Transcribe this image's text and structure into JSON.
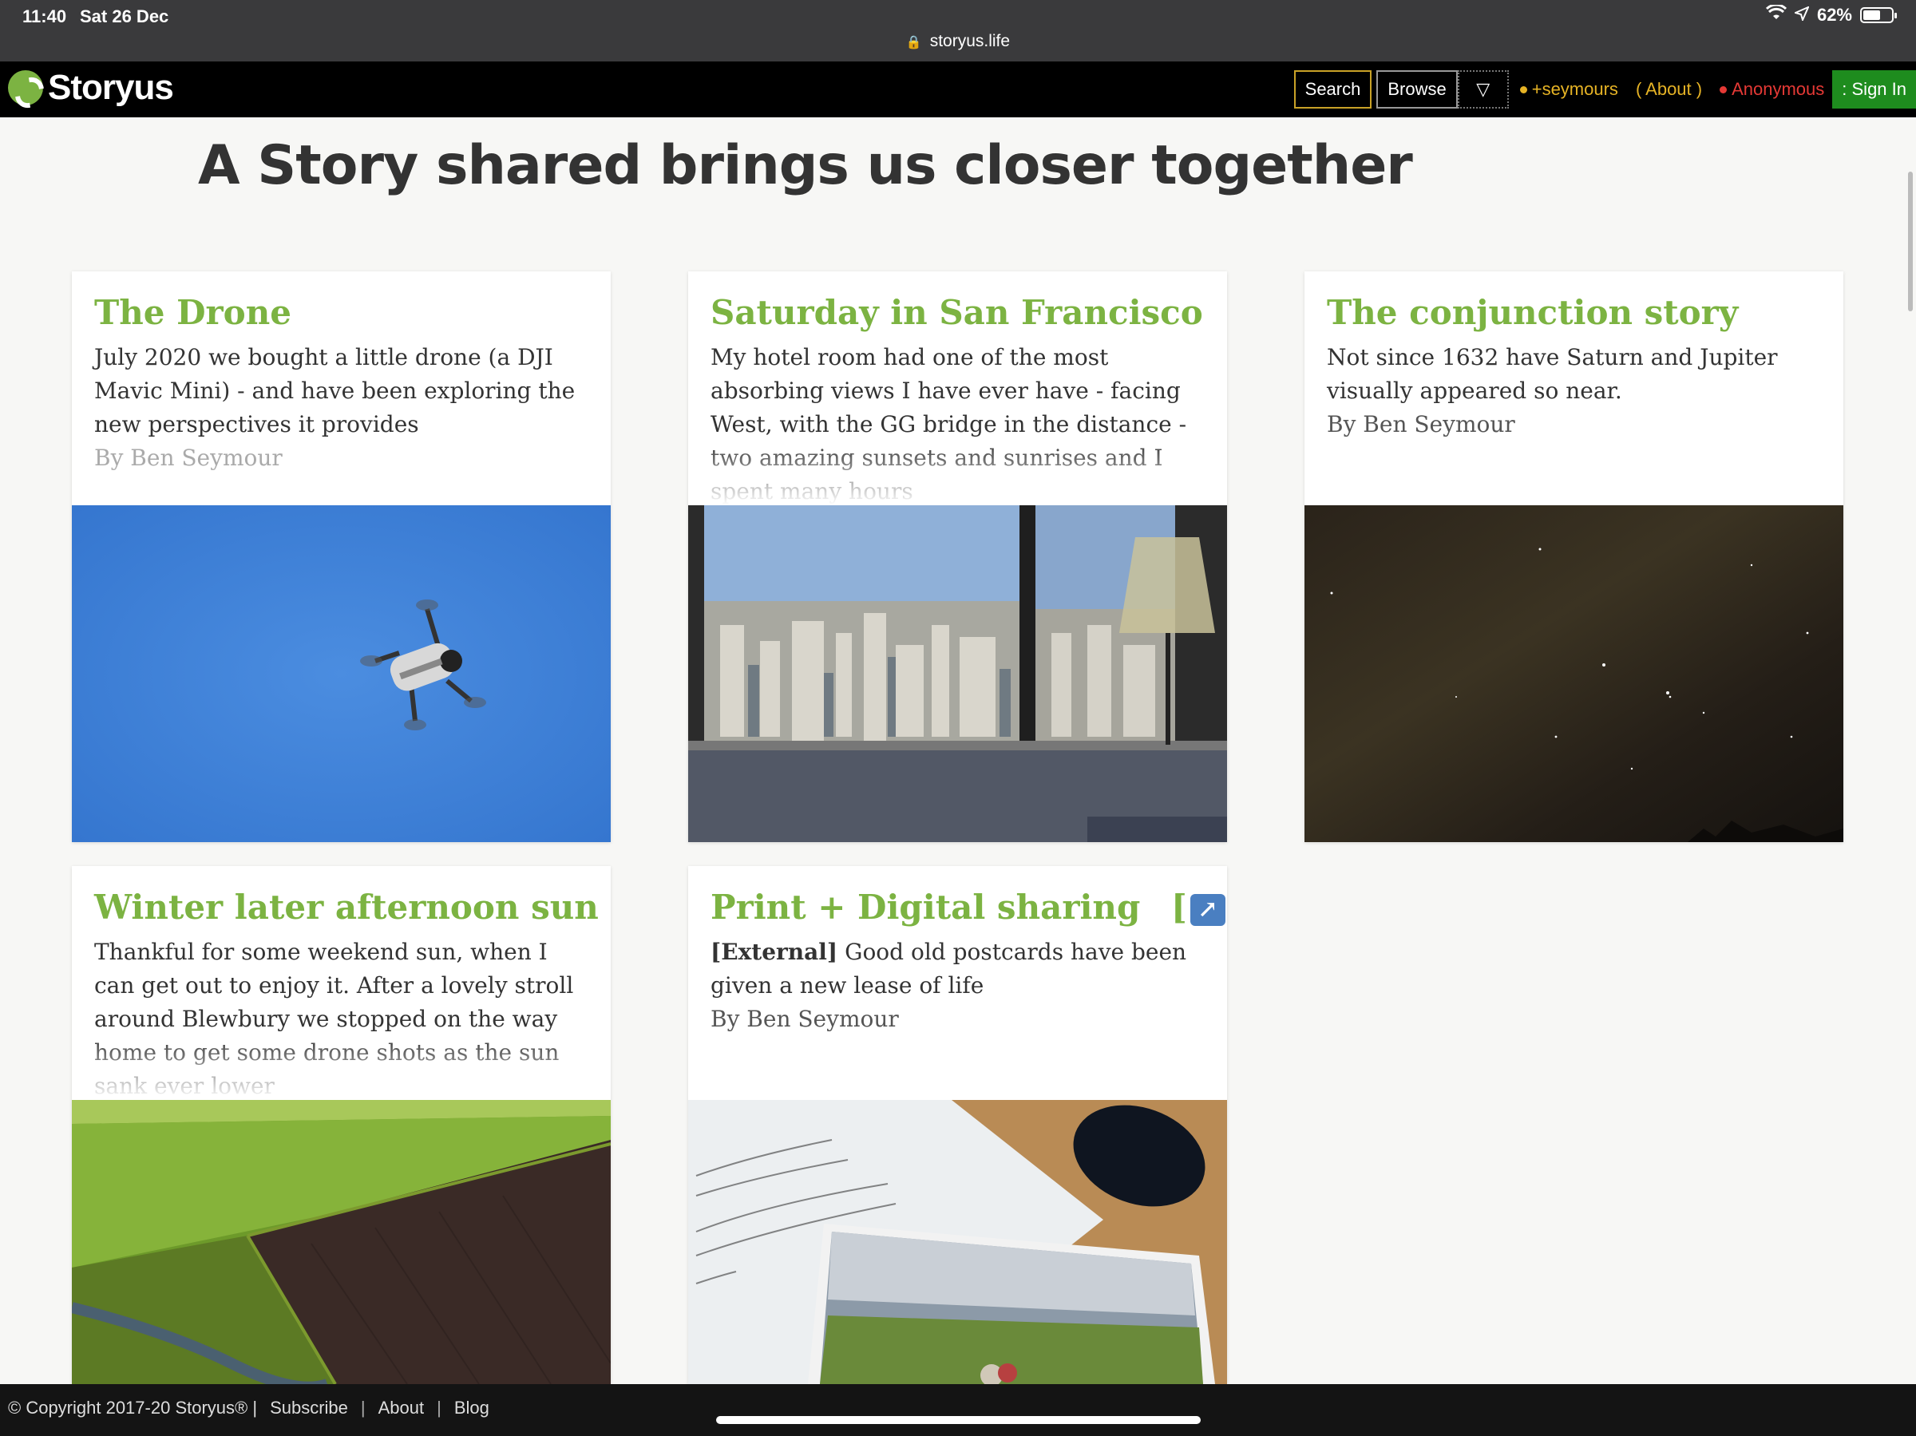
{
  "status_bar": {
    "time": "11:40",
    "date": "Sat 26 Dec",
    "url": "storyus.life",
    "battery_text": "62%",
    "battery_level": 0.62
  },
  "nav": {
    "logo_text": "Storyus",
    "search_label": "Search",
    "browse_label": "Browse",
    "filter_symbol": "▽",
    "user_label": "+seymours",
    "about_label": "( About )",
    "anonymous_label": "Anonymous",
    "signin_label": ": Sign In"
  },
  "headline": "A Story shared brings us closer together",
  "cards": [
    {
      "title": "The Drone",
      "body": "July 2020 we bought a little drone (a DJI Mavic Mini) - and have been exploring the new perspectives it provides",
      "byline": "By Ben Seymour",
      "image_desc": "drone in blue sky"
    },
    {
      "title": "Saturday in San Francisco",
      "body": "My hotel room had one of the most absorbing views I have ever have - facing West, with the GG bridge in the distance - two amazing sunsets and sunrises and I spent many hours",
      "byline": "",
      "image_desc": "city view from hotel window"
    },
    {
      "title": "The conjunction story",
      "body": "Not since 1632 have Saturn and Jupiter visually appeared so near.",
      "byline": "By Ben Seymour",
      "image_desc": "night sky with stars"
    },
    {
      "title": "Winter later afternoon sun",
      "body": "Thankful for some weekend sun, when I can get out to enjoy it. After a lovely stroll around Blewbury we stopped on the way home to get some drone shots as the sun sank ever lower",
      "byline": "",
      "image_desc": "aerial view of green fields"
    },
    {
      "title": "Print + Digital sharing",
      "title_suffix_open": "[",
      "title_suffix_icon": "↗",
      "title_suffix_close": "]",
      "external_tag": "[External]",
      "body": "Good old postcards have been given a new lease of life",
      "byline": "By Ben Seymour",
      "image_desc": "postcards and mouse on desk"
    }
  ],
  "footer": {
    "copyright": "© Copyright 2017-20 Storyus® |",
    "subscribe": "Subscribe",
    "about": "About",
    "blog": "Blog",
    "sep": "|"
  },
  "colors": {
    "accent_green": "#7cb342",
    "nav_bg": "#000000",
    "signin_green": "#1e8c1e",
    "anonymous_red": "#e53935",
    "user_gold": "#e6b325"
  }
}
